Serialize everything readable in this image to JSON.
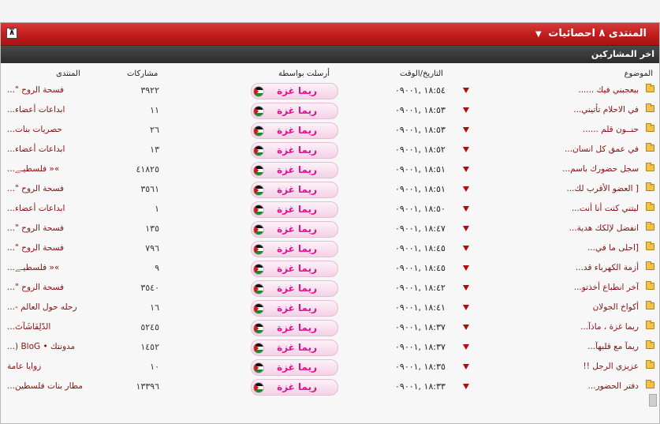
{
  "header": {
    "collapse_symbol": "⊼",
    "title": "المنتدى ٨ احصائيات",
    "dropdown_symbol": "▼",
    "subtitle": "اخر المشاركين"
  },
  "columns": {
    "topic": "الموضوع",
    "datetime": "التاريخ/الوقت",
    "poster": "أرسلت بواسطة",
    "posts": "مشاركات",
    "forum": "المنتدى"
  },
  "colors": {
    "title_bar": "#c01c1c",
    "sub_bar": "#333333",
    "link": "#8a1010",
    "poster_name": "#e0118f"
  },
  "rows": [
    {
      "topic": "بيعجبني فيك ......",
      "date": "١٨:٥٤ ,٠٩٠٠١",
      "poster": "ريما غزة",
      "count": "٣٩٢٢",
      "forum": "فسحة الروح \"..."
    },
    {
      "topic": "في الاحلام تأتيني...",
      "date": "١٨:٥٣ ,٠٩٠٠١",
      "poster": "ريما غزة",
      "count": "١١",
      "forum": "ابداعات أعضاء..."
    },
    {
      "topic": "حنــون قلم ......",
      "date": "١٨:٥٣ ,٠٩٠٠١",
      "poster": "ريما غزة",
      "count": "٢٦",
      "forum": "حصريات بنات..."
    },
    {
      "topic": "في عمق كل انسان...",
      "date": "١٨:٥٢ ,٠٩٠٠١",
      "poster": "ريما غزة",
      "count": "١٣",
      "forum": "ابداعات أعضاء..."
    },
    {
      "topic": "سجل حضورك باسم...",
      "date": "١٨:٥١ ,٠٩٠٠١",
      "poster": "ريما غزة",
      "count": "٤١٨٢٥",
      "forum": "»« فلسطيـﮯ..."
    },
    {
      "topic": "[ العضو الأقرب لك...",
      "date": "١٨:٥١ ,٠٩٠٠١",
      "poster": "ريما غزة",
      "count": "٣٥٦١",
      "forum": "فسحة الروح \"..."
    },
    {
      "topic": "ليتني كنت أنا أنت...",
      "date": "١٨:٥٠ ,٠٩٠٠١",
      "poster": "ريما غزة",
      "count": "١",
      "forum": "ابداعات أعضاء..."
    },
    {
      "topic": "انفضل لإلكك هدية...",
      "date": "١٨:٤٧ ,٠٩٠٠١",
      "poster": "ريما غزة",
      "count": "١٣٥",
      "forum": "فسحة الروح \"..."
    },
    {
      "topic": "[احلى ما في...",
      "date": "١٨:٤٥ ,٠٩٠٠١",
      "poster": "ريما غزة",
      "count": "٧٩٦",
      "forum": "فسحة الروح \"..."
    },
    {
      "topic": "أزمة الكهرباء قد...",
      "date": "١٨:٤٥ ,٠٩٠٠١",
      "poster": "ريما غزة",
      "count": "٩",
      "forum": "»« فلسطيـﮯ..."
    },
    {
      "topic": "آخر انطباع أخذتو...",
      "date": "١٨:٤٢ ,٠٩٠٠١",
      "poster": "ريما غزة",
      "count": "٣٥٤٠",
      "forum": "فسحة الروح \"..."
    },
    {
      "topic": "أكواخ الجولان",
      "date": "١٨:٤١ ,٠٩٠٠١",
      "poster": "ريما غزة",
      "count": "١٦",
      "forum": "رحله حول العالم -..."
    },
    {
      "topic": "ريما غزة ، ماذآ...",
      "date": "١٨:٣٧ ,٠٩٠٠١",
      "poster": "ريما غزة",
      "count": "٥٢٤٥",
      "forum": "الدّلِفَاشَآتَ..."
    },
    {
      "topic": "ريمآ مع قلبهآ...",
      "date": "١٨:٣٧ ,٠٩٠٠١",
      "poster": "ريما غزة",
      "count": "١٤٥٢",
      "forum": "مدونتك • BloG (..."
    },
    {
      "topic": "عزيزي الرجل !!",
      "date": "١٨:٣٥ ,٠٩٠٠١",
      "poster": "ريما غزة",
      "count": "١٠",
      "forum": "زوايا عامة"
    },
    {
      "topic": "دفتر الحضور...",
      "date": "١٨:٣٣ ,٠٩٠٠١",
      "poster": "ريما غزة",
      "count": "١٣٣٩٦",
      "forum": "مطار بنات فلسطين..."
    }
  ]
}
